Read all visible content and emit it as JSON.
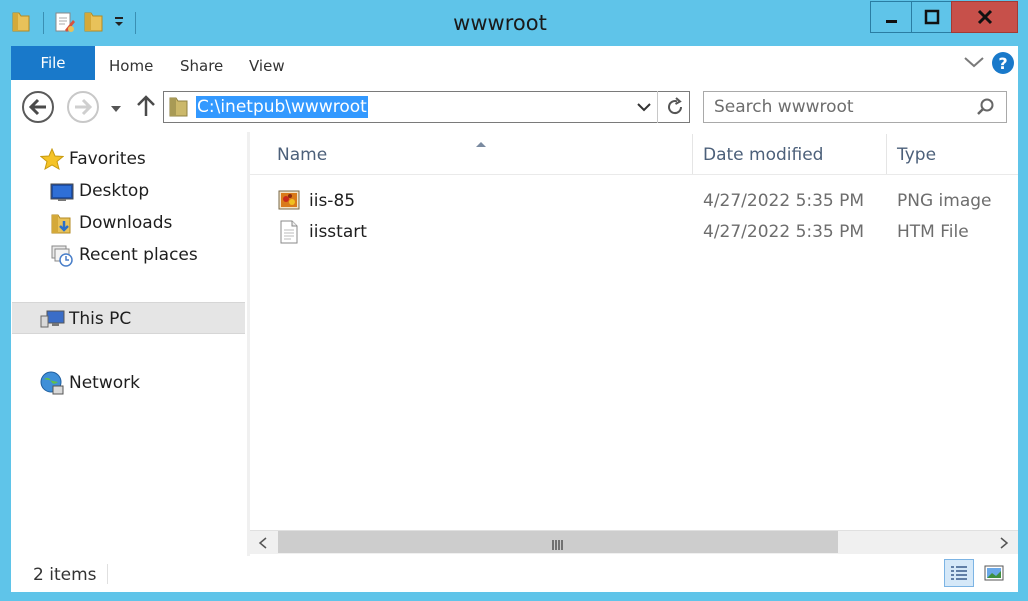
{
  "window": {
    "title": "wwwroot"
  },
  "ribbon": {
    "tabs": [
      "File",
      "Home",
      "Share",
      "View"
    ]
  },
  "address": {
    "path": "C:\\inetpub\\wwwroot"
  },
  "search": {
    "placeholder": "Search wwwroot"
  },
  "nav": {
    "favorites": "Favorites",
    "desktop": "Desktop",
    "downloads": "Downloads",
    "recent": "Recent places",
    "this_pc": "This PC",
    "network": "Network"
  },
  "columns": {
    "name": "Name",
    "date": "Date modified",
    "type": "Type"
  },
  "files": [
    {
      "name": "iis-85",
      "date": "4/27/2022 5:35 PM",
      "type": "PNG image",
      "icon": "png-image-icon"
    },
    {
      "name": "iisstart",
      "date": "4/27/2022 5:35 PM",
      "type": "HTM File",
      "icon": "htm-file-icon"
    }
  ],
  "status": {
    "count": "2 items"
  },
  "colors": {
    "chrome": "#5fc4e9",
    "file_tab": "#1979ca",
    "close": "#c7504a",
    "selection": "#3399ff",
    "header_text": "#4c607a"
  }
}
